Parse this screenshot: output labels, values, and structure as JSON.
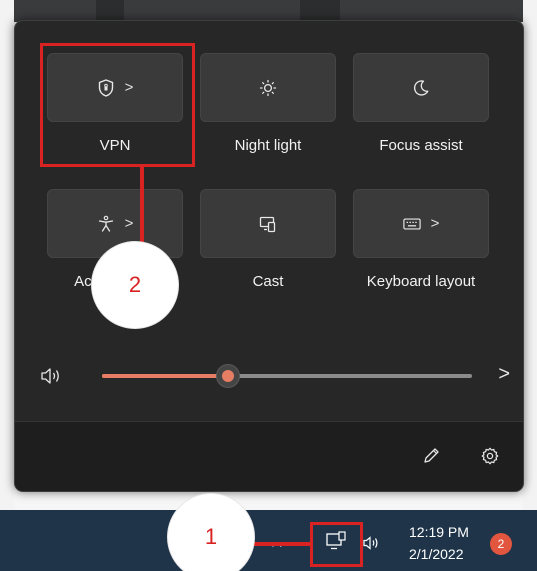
{
  "quick_settings": {
    "tiles": [
      {
        "label": "VPN",
        "icon": "shield-icon",
        "has_chevron": true
      },
      {
        "label": "Night light",
        "icon": "brightness-icon",
        "has_chevron": false
      },
      {
        "label": "Focus assist",
        "icon": "moon-icon",
        "has_chevron": false
      },
      {
        "label": "Accessibility",
        "icon": "accessibility-icon",
        "has_chevron": true
      },
      {
        "label": "Cast",
        "icon": "cast-icon",
        "has_chevron": false
      },
      {
        "label": "Keyboard layout",
        "icon": "keyboard-icon",
        "has_chevron": true
      }
    ],
    "chevron": ">",
    "volume": {
      "level_percent": 34,
      "icon": "speaker-icon"
    },
    "next_chevron": ">",
    "footer": {
      "edit_icon": "pencil-icon",
      "settings_icon": "gear-icon"
    }
  },
  "taskbar": {
    "clock_time": "12:19 PM",
    "clock_date": "2/1/2022",
    "notification_count": "2",
    "tray_glyph": "ꟷ",
    "tray_icons": [
      "network-icon",
      "speaker-icon"
    ]
  },
  "annotations": {
    "step1": "1",
    "step2": "2",
    "color": "#d92323"
  },
  "colors": {
    "accent": "#e77e63",
    "panel_bg": "#272727",
    "tile_bg": "#3a3a3a",
    "taskbar_bg": "#1f3448",
    "badge": "#e2553f"
  }
}
